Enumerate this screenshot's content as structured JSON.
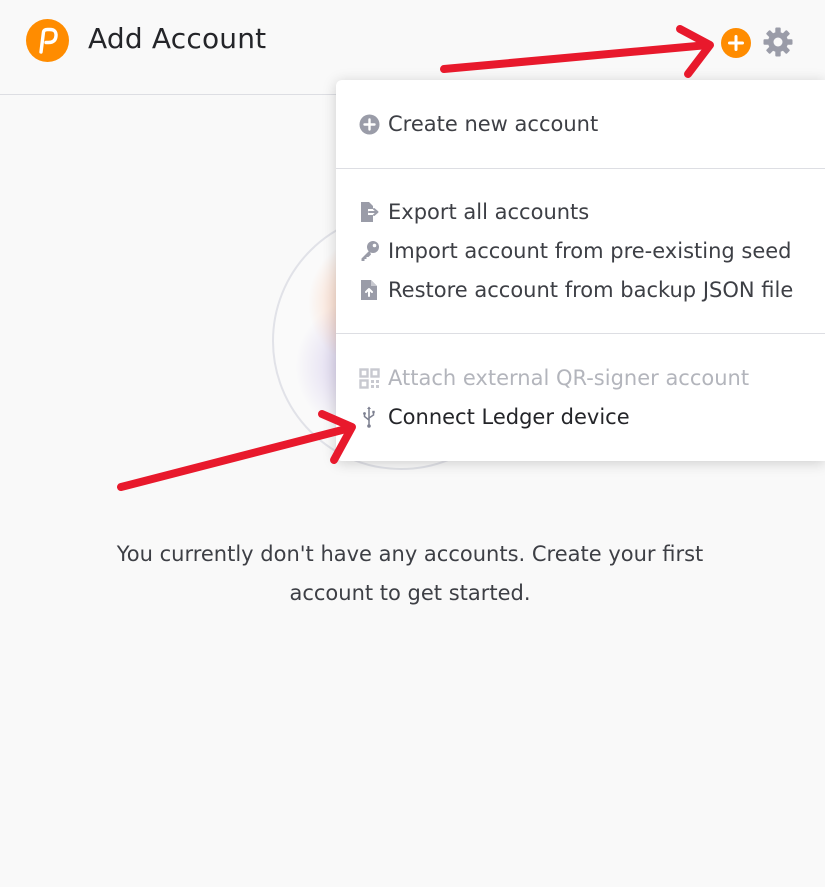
{
  "header": {
    "title": "Add Account"
  },
  "menu": {
    "sections": [
      {
        "items": [
          {
            "label": "Create new account",
            "icon": "plus-circle-icon",
            "enabled": true
          }
        ]
      },
      {
        "items": [
          {
            "label": "Export all accounts",
            "icon": "file-export-icon",
            "enabled": true
          },
          {
            "label": "Import account from pre-existing seed",
            "icon": "key-icon",
            "enabled": true
          },
          {
            "label": "Restore account from backup JSON file",
            "icon": "file-upload-icon",
            "enabled": true
          }
        ]
      },
      {
        "items": [
          {
            "label": "Attach external QR-signer account",
            "icon": "qrcode-icon",
            "enabled": false
          },
          {
            "label": "Connect Ledger device",
            "icon": "usb-icon",
            "enabled": true
          }
        ]
      }
    ]
  },
  "empty_state": {
    "line1": "You currently don't have any accounts. Create your first",
    "line2": "account to get started."
  },
  "colors": {
    "accent": "#ff8c00",
    "annotation_arrow": "#e8192c",
    "icon_gray": "#9a9ca8"
  }
}
